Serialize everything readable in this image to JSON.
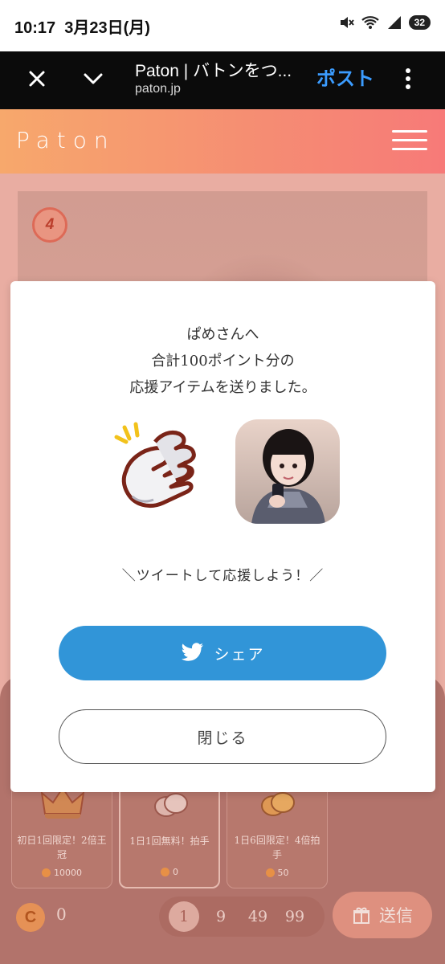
{
  "status_bar": {
    "time": "10:17",
    "date": "3月23日(月)",
    "battery": "32"
  },
  "browser": {
    "page_title": "Paton | バトンをつ...",
    "url": "paton.jp",
    "post_label": "ポスト",
    "accent_color": "#3b9cff"
  },
  "site": {
    "logo": "Paton"
  },
  "background": {
    "rank": "4",
    "items": [
      {
        "label": "初日1回限定！2倍王冠",
        "cost": "10000",
        "icon": "crown-icon"
      },
      {
        "label": "1日1回無料！拍手",
        "cost": "0",
        "icon": "clap-icon"
      },
      {
        "label": "1日6回限定！4倍拍手",
        "cost": "50",
        "icon": "clap-gold-icon"
      }
    ],
    "coin_symbol": "C",
    "coin_balance": "0",
    "quantities": [
      "1",
      "9",
      "49",
      "99"
    ],
    "selected_quantity": "1",
    "send_label": "送信"
  },
  "modal": {
    "message_line1": "ぱめさんへ",
    "message_line2": "合計100ポイント分の",
    "message_line3": "応援アイテムを送りました。",
    "cta": "＼ツイートして応援しよう！／",
    "share_label": "シェア",
    "close_label": "閉じる",
    "share_color": "#3195d8"
  }
}
